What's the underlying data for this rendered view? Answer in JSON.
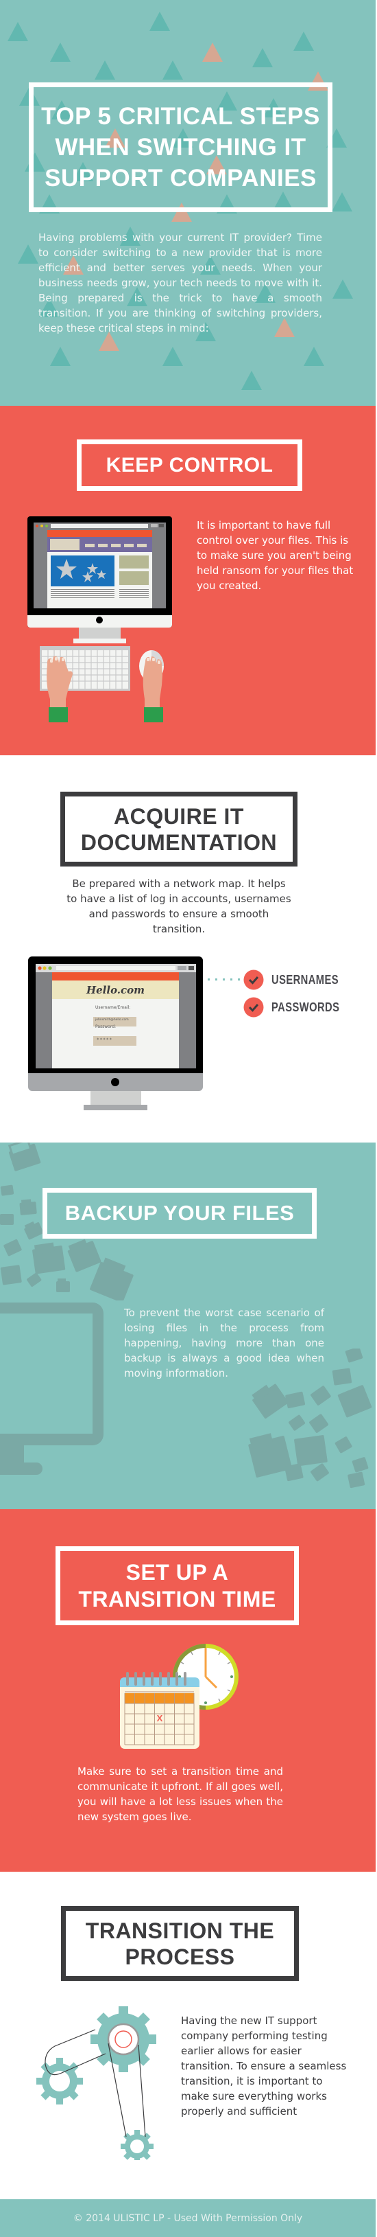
{
  "hero": {
    "title": "TOP 5 CRITICAL STEPS WHEN SWITCHING IT SUPPORT COMPANIES",
    "title_lines": [
      "TOP 5 CRITICAL STEPS",
      "WHEN SWITCHING IT",
      "SUPPORT COMPANIES"
    ],
    "intro": "Having problems with your current IT provider? Time to consider switching to a new provider that is more efficient and better serves your needs. When your business needs grow, your tech needs to move with it. Being prepared is the trick to have a smooth transition. If you are thinking of switching providers, keep these critical steps in mind:"
  },
  "steps": [
    {
      "title": "KEEP CONTROL",
      "body": "It is important to have full control over your files. This is to make sure you aren't being held ransom for your files that you created.",
      "illustration": "desktop-computer-keyboard-mouse-hands"
    },
    {
      "title_lines": [
        "ACQUIRE IT",
        "DOCUMENTATION"
      ],
      "body": "Be prepared with a network map. It helps to have a list of log in accounts, usernames and passwords to ensure a smooth transition.",
      "illustration": "desktop-login-form",
      "login_screen": {
        "site": "Hello.com",
        "username_label": "Username/Email:",
        "username_value": "johnsmith@hello.com",
        "password_label": "Password:",
        "password_value": "*****"
      },
      "checklist": [
        "USERNAMES",
        "PASSWORDS"
      ]
    },
    {
      "title": "BACKUP YOUR FILES",
      "body": "To prevent the worst case scenario of losing files in the process from happening, having more than one backup is always a good idea when moving information.",
      "illustration": "monitor-with-flying-folders"
    },
    {
      "title_lines": [
        "SET UP A",
        "TRANSITION TIME"
      ],
      "body": "Make sure to set a transition time and communicate it upfront. If all goes well, you will have a lot less issues when the new system goes live.",
      "illustration": "calendar-and-clock",
      "calendar_mark": "X"
    },
    {
      "title_lines": [
        "TRANSITION THE",
        "PROCESS"
      ],
      "body": "Having the new IT support company performing testing earlier allows for easier transition. To ensure a seamless transition, it is important to make sure everything works properly and sufficient",
      "illustration": "gears-with-belt"
    }
  ],
  "footer": {
    "text": "© 2014 ULISTIC LP - Used With Permission Only"
  },
  "colors": {
    "teal": "#84c3bd",
    "teal_dark": "#62b8b0",
    "coral": "#f05d52",
    "peach": "#d6a792",
    "charcoal": "#3c3c3e",
    "white": "#ffffff"
  }
}
